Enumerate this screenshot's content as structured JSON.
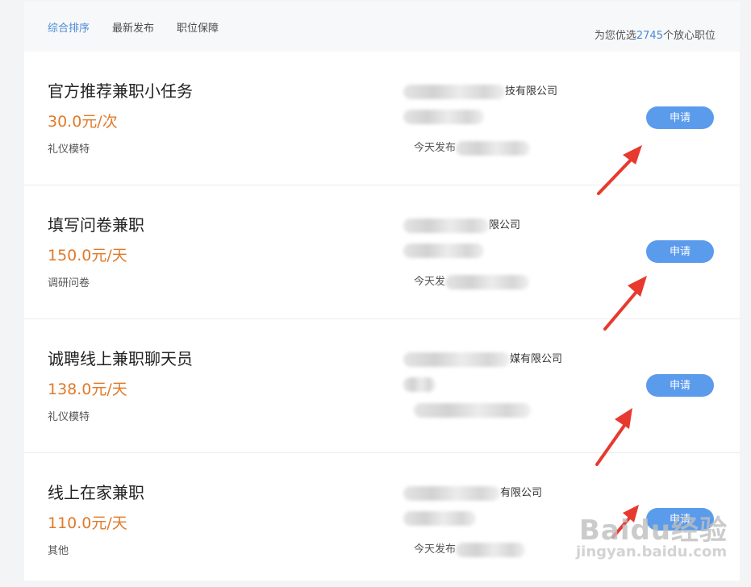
{
  "tabs": [
    {
      "label": "综合排序",
      "active": true
    },
    {
      "label": "最新发布",
      "active": false
    },
    {
      "label": "职位保障",
      "active": false
    }
  ],
  "summary": {
    "prefix": "为您优选",
    "count": "2745",
    "suffix": "个放心职位"
  },
  "jobs": [
    {
      "title": "官方推荐兼职小任务",
      "salary": "30.0元/次",
      "category": "礼仪模特",
      "company_visible": "技有限公司",
      "pub_visible": "今天发布",
      "apply": "申请"
    },
    {
      "title": "填写问卷兼职",
      "salary": "150.0元/天",
      "category": "调研问卷",
      "company_visible": "限公司",
      "pub_visible": "今天发",
      "apply": "申请"
    },
    {
      "title": "诚聘线上兼职聊天员",
      "salary": "138.0元/天",
      "category": "礼仪模特",
      "company_visible": "媒有限公司",
      "pub_visible": "",
      "apply": "申请"
    },
    {
      "title": "线上在家兼职",
      "salary": "110.0元/天",
      "category": "其他",
      "company_visible": "有限公司",
      "pub_visible": "今天发布",
      "apply": "申请"
    }
  ],
  "colors": {
    "accent": "#4a8ad6",
    "salary": "#e07a2b",
    "button": "#5b9bec",
    "arrow": "#e8392e"
  },
  "watermark": {
    "logo": "Baidu经验",
    "sub": "jingyan.baidu.com"
  }
}
